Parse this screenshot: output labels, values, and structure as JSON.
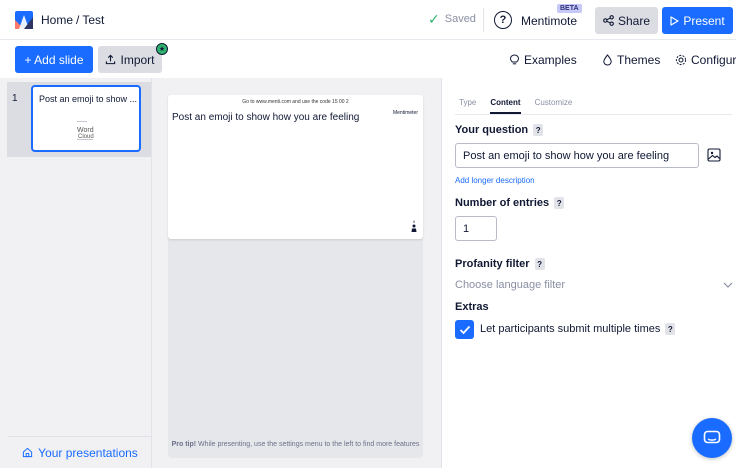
{
  "header": {
    "breadcrumb_home": "Home",
    "breadcrumb_sep": "/",
    "breadcrumb_current": "Test",
    "saved_label": "Saved",
    "help_label": "?",
    "mentimote_label": "Mentimote",
    "beta_label": "BETA",
    "share_label": "Share",
    "present_label": "Present"
  },
  "toolbar": {
    "add_slide_label": "+ Add slide",
    "import_label": "Import",
    "examples_label": "Examples",
    "themes_label": "Themes",
    "configure_label": "Configure"
  },
  "slides": [
    {
      "number": "1",
      "title": "Post an emoji to show ...",
      "thumb_word1": "Word",
      "thumb_word2": "Cloud"
    }
  ],
  "sidebar": {
    "your_presentations_label": "Your presentations"
  },
  "preview": {
    "code_text": "Go to www.menti.com and use the code 15 00 2",
    "brand": "Mentimeter",
    "title": "Post an emoji to show how you are feeling",
    "participant_count": "0",
    "protip_bold": "Pro tip!",
    "protip_text": " While presenting, use the settings menu to the left to find more features"
  },
  "editor": {
    "tabs": [
      "Type",
      "Content",
      "Customize"
    ],
    "active_tab": "Content",
    "question_label": "Your question",
    "question_value": "Post an emoji to show how you are feeling",
    "add_description_label": "Add longer description",
    "entries_label": "Number of entries",
    "entries_value": "1",
    "profanity_label": "Profanity filter",
    "profanity_placeholder": "Choose language filter",
    "extras_label": "Extras",
    "multiple_label": "Let participants submit multiple times",
    "multiple_checked": true,
    "help_badge": "?"
  },
  "colors": {
    "accent": "#196cff",
    "saved": "#2fb470",
    "text": "#101834",
    "muted": "#8a8fa3"
  }
}
